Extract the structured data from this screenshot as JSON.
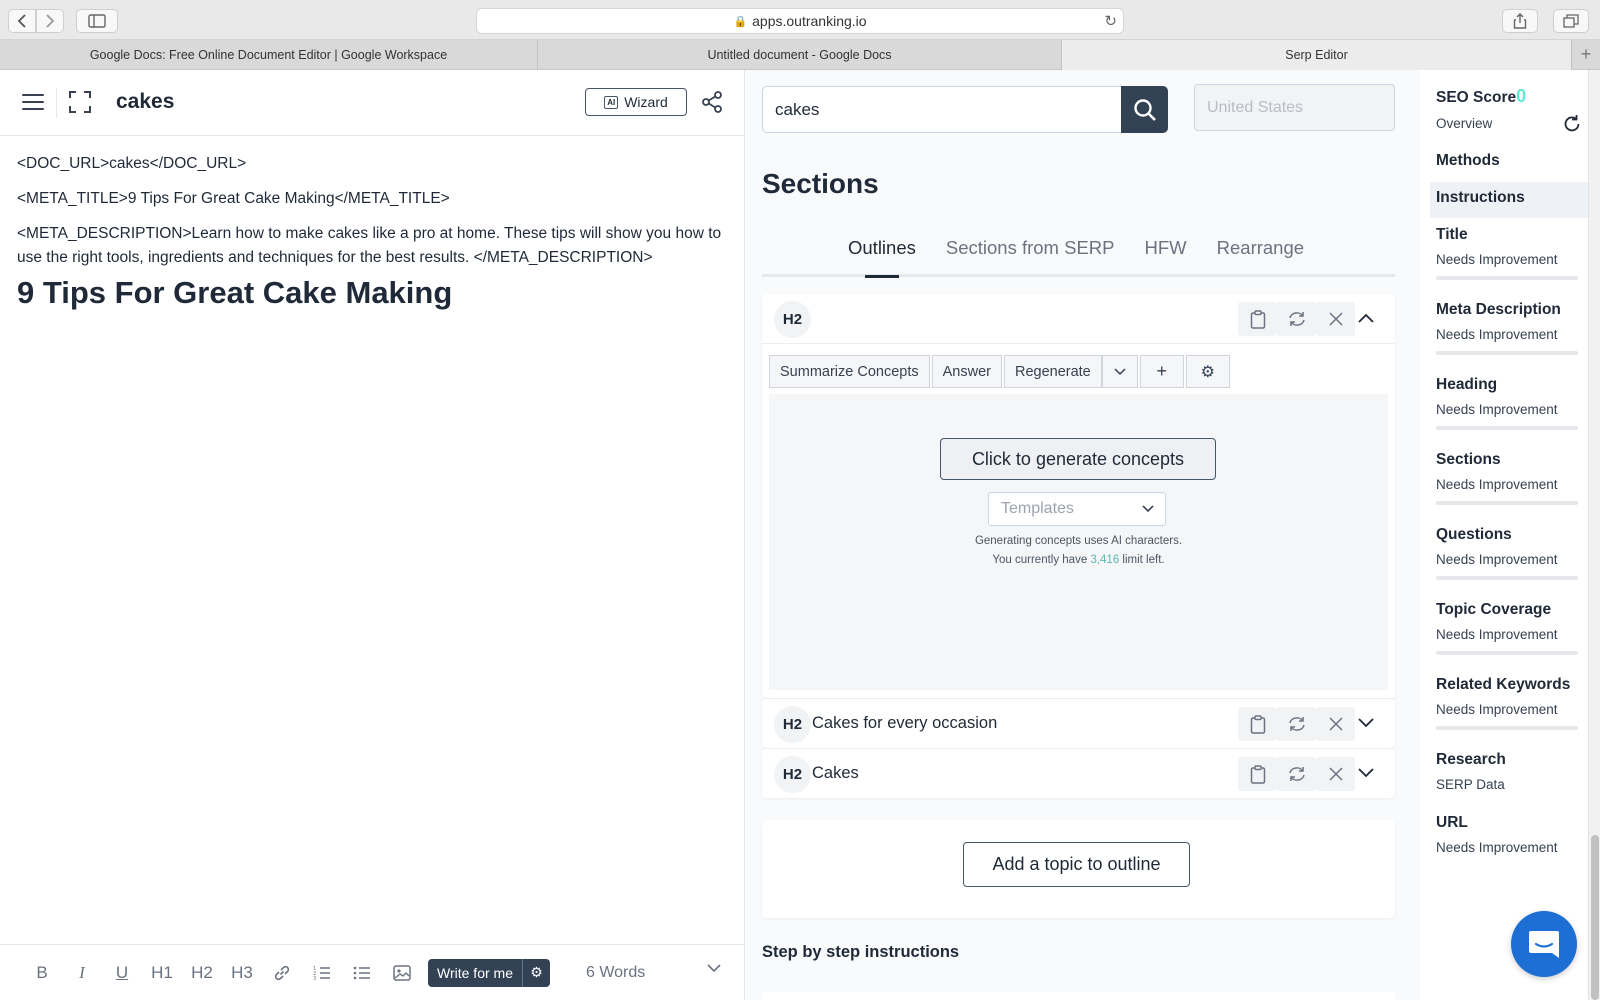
{
  "browser": {
    "url": "apps.outranking.io",
    "tabs": [
      {
        "title": "Google Docs: Free Online Document Editor | Google Workspace"
      },
      {
        "title": "Untitled document - Google Docs"
      },
      {
        "title": "Serp Editor"
      }
    ]
  },
  "editor": {
    "doc_title": "cakes",
    "wizard_label": "Wizard",
    "wizard_ai_badge": "AI",
    "line_doc_url": "<DOC_URL>cakes</DOC_URL>",
    "line_meta_title": "<META_TITLE>9 Tips For Great Cake Making</META_TITLE>",
    "line_meta_description": "<META_DESCRIPTION>Learn how to make cakes like a pro at home. These tips will show you how to use the right tools, ingredients and techniques for the best results. </META_DESCRIPTION>",
    "heading": "9 Tips For Great Cake Making",
    "toolbar": {
      "bold": "B",
      "italic": "I",
      "underline": "U",
      "h1": "H1",
      "h2": "H2",
      "h3": "H3",
      "write_label": "Write for me",
      "word_count": "6 Words"
    }
  },
  "serp": {
    "search_value": "cakes",
    "country_placeholder": "United States",
    "sections_title": "Sections",
    "tabs": [
      {
        "label": "Outlines"
      },
      {
        "label": "Sections from SERP"
      },
      {
        "label": "HFW"
      },
      {
        "label": "Rearrange"
      }
    ],
    "outline": [
      {
        "badge": "H2",
        "text": ""
      },
      {
        "badge": "H2",
        "text": "Cakes for every occasion"
      },
      {
        "badge": "H2",
        "text": "Cakes"
      }
    ],
    "concept_buttons": {
      "summarize": "Summarize Concepts",
      "answer": "Answer",
      "regenerate": "Regenerate",
      "add": "+"
    },
    "generate_label": "Click to generate concepts",
    "templates_placeholder": "Templates",
    "note_line1": "Generating concepts uses AI characters.",
    "note_prefix": "You currently have",
    "note_limit": "3,416",
    "note_suffix": "limit left.",
    "add_topic_label": "Add a topic to outline",
    "step_title": "Step by step instructions"
  },
  "rpanel": {
    "seo_score_label": "SEO Score",
    "seo_score_value": "0",
    "overview": "Overview",
    "methods": "Methods",
    "instructions": "Instructions",
    "items": [
      {
        "label": "Title",
        "status": "Needs Improvement"
      },
      {
        "label": "Meta Description",
        "status": "Needs Improvement"
      },
      {
        "label": "Heading",
        "status": "Needs Improvement"
      },
      {
        "label": "Sections",
        "status": "Needs Improvement"
      },
      {
        "label": "Questions",
        "status": "Needs Improvement"
      },
      {
        "label": "Topic Coverage",
        "status": "Needs Improvement"
      },
      {
        "label": "Related Keywords",
        "status": "Needs Improvement"
      }
    ],
    "research": "Research",
    "serp_data": "SERP Data",
    "url_label": "URL",
    "url_status": "Needs Improvement"
  },
  "colors": {
    "primary_dark": "#334155",
    "accent_teal": "#5eead4",
    "chat_blue": "#1d6fd6"
  }
}
